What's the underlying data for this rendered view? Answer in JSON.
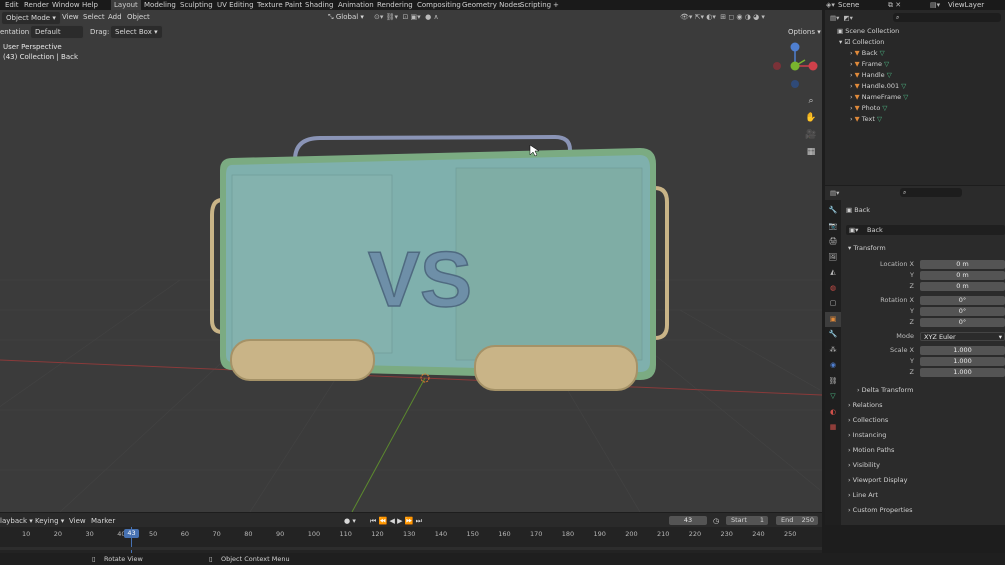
{
  "menubar": {
    "items": [
      "Edit",
      "Render",
      "Window",
      "Help"
    ],
    "workspaces": [
      "Layout",
      "Modeling",
      "Sculpting",
      "UV Editing",
      "Texture Paint",
      "Shading",
      "Animation",
      "Rendering",
      "Compositing",
      "Geometry Nodes",
      "Scripting"
    ],
    "active_workspace": "Layout",
    "add_tab": "+",
    "scene": "Scene",
    "view_layer": "ViewLayer"
  },
  "viewport": {
    "mode": "Object Mode",
    "menus": [
      "View",
      "Select",
      "Add",
      "Object"
    ],
    "transform_orientation": "Global",
    "orientation_label": "entation:",
    "orientation_value": "Default",
    "drag_label": "Drag:",
    "drag_value": "Select Box",
    "options": "Options",
    "overlay_title": "User Perspective",
    "overlay_subtitle": "(43) Collection | Back",
    "model_text": "VS"
  },
  "outliner": {
    "root": "Scene Collection",
    "collection": "Collection",
    "objects": [
      "Back",
      "Frame",
      "Handle",
      "Handle.001",
      "NameFrame",
      "Photo",
      "Text"
    ]
  },
  "properties": {
    "object_name": "Back",
    "object_field": "Back",
    "transform_header": "Transform",
    "location": {
      "label": "Location X",
      "x": "0 m",
      "y": "0 m",
      "z": "0 m"
    },
    "rotation": {
      "label": "Rotation X",
      "x": "0°",
      "y": "0°",
      "z": "0°"
    },
    "mode_label": "Mode",
    "mode_value": "XYZ Euler",
    "scale": {
      "label": "Scale X",
      "x": "1.000",
      "y": "1.000",
      "z": "1.000"
    },
    "axis_y": "Y",
    "axis_z": "Z",
    "delta": "Delta Transform",
    "panels": [
      "Relations",
      "Collections",
      "Instancing",
      "Motion Paths",
      "Visibility",
      "Viewport Display",
      "Line Art",
      "Custom Properties"
    ]
  },
  "timeline": {
    "menus": [
      "layback",
      "Keying",
      "View",
      "Marker"
    ],
    "current_frame": "43",
    "start_label": "Start",
    "start": "1",
    "end_label": "End",
    "end": "250",
    "ticks": [
      "10",
      "20",
      "30",
      "40",
      "50",
      "60",
      "70",
      "80",
      "90",
      "100",
      "110",
      "120",
      "130",
      "140",
      "150",
      "160",
      "170",
      "180",
      "190",
      "200",
      "210",
      "220",
      "230",
      "240",
      "250"
    ]
  },
  "status": {
    "rotate": "Rotate View",
    "context": "Object Context Menu"
  },
  "colors": {
    "viewport_bg": "#3b3b3b",
    "body_green": "#7bab82",
    "screen_teal": "#7fb0ad",
    "tan": "#c9b487",
    "frame_blue": "#8a94b6",
    "accent_blue": "#4772b3"
  }
}
